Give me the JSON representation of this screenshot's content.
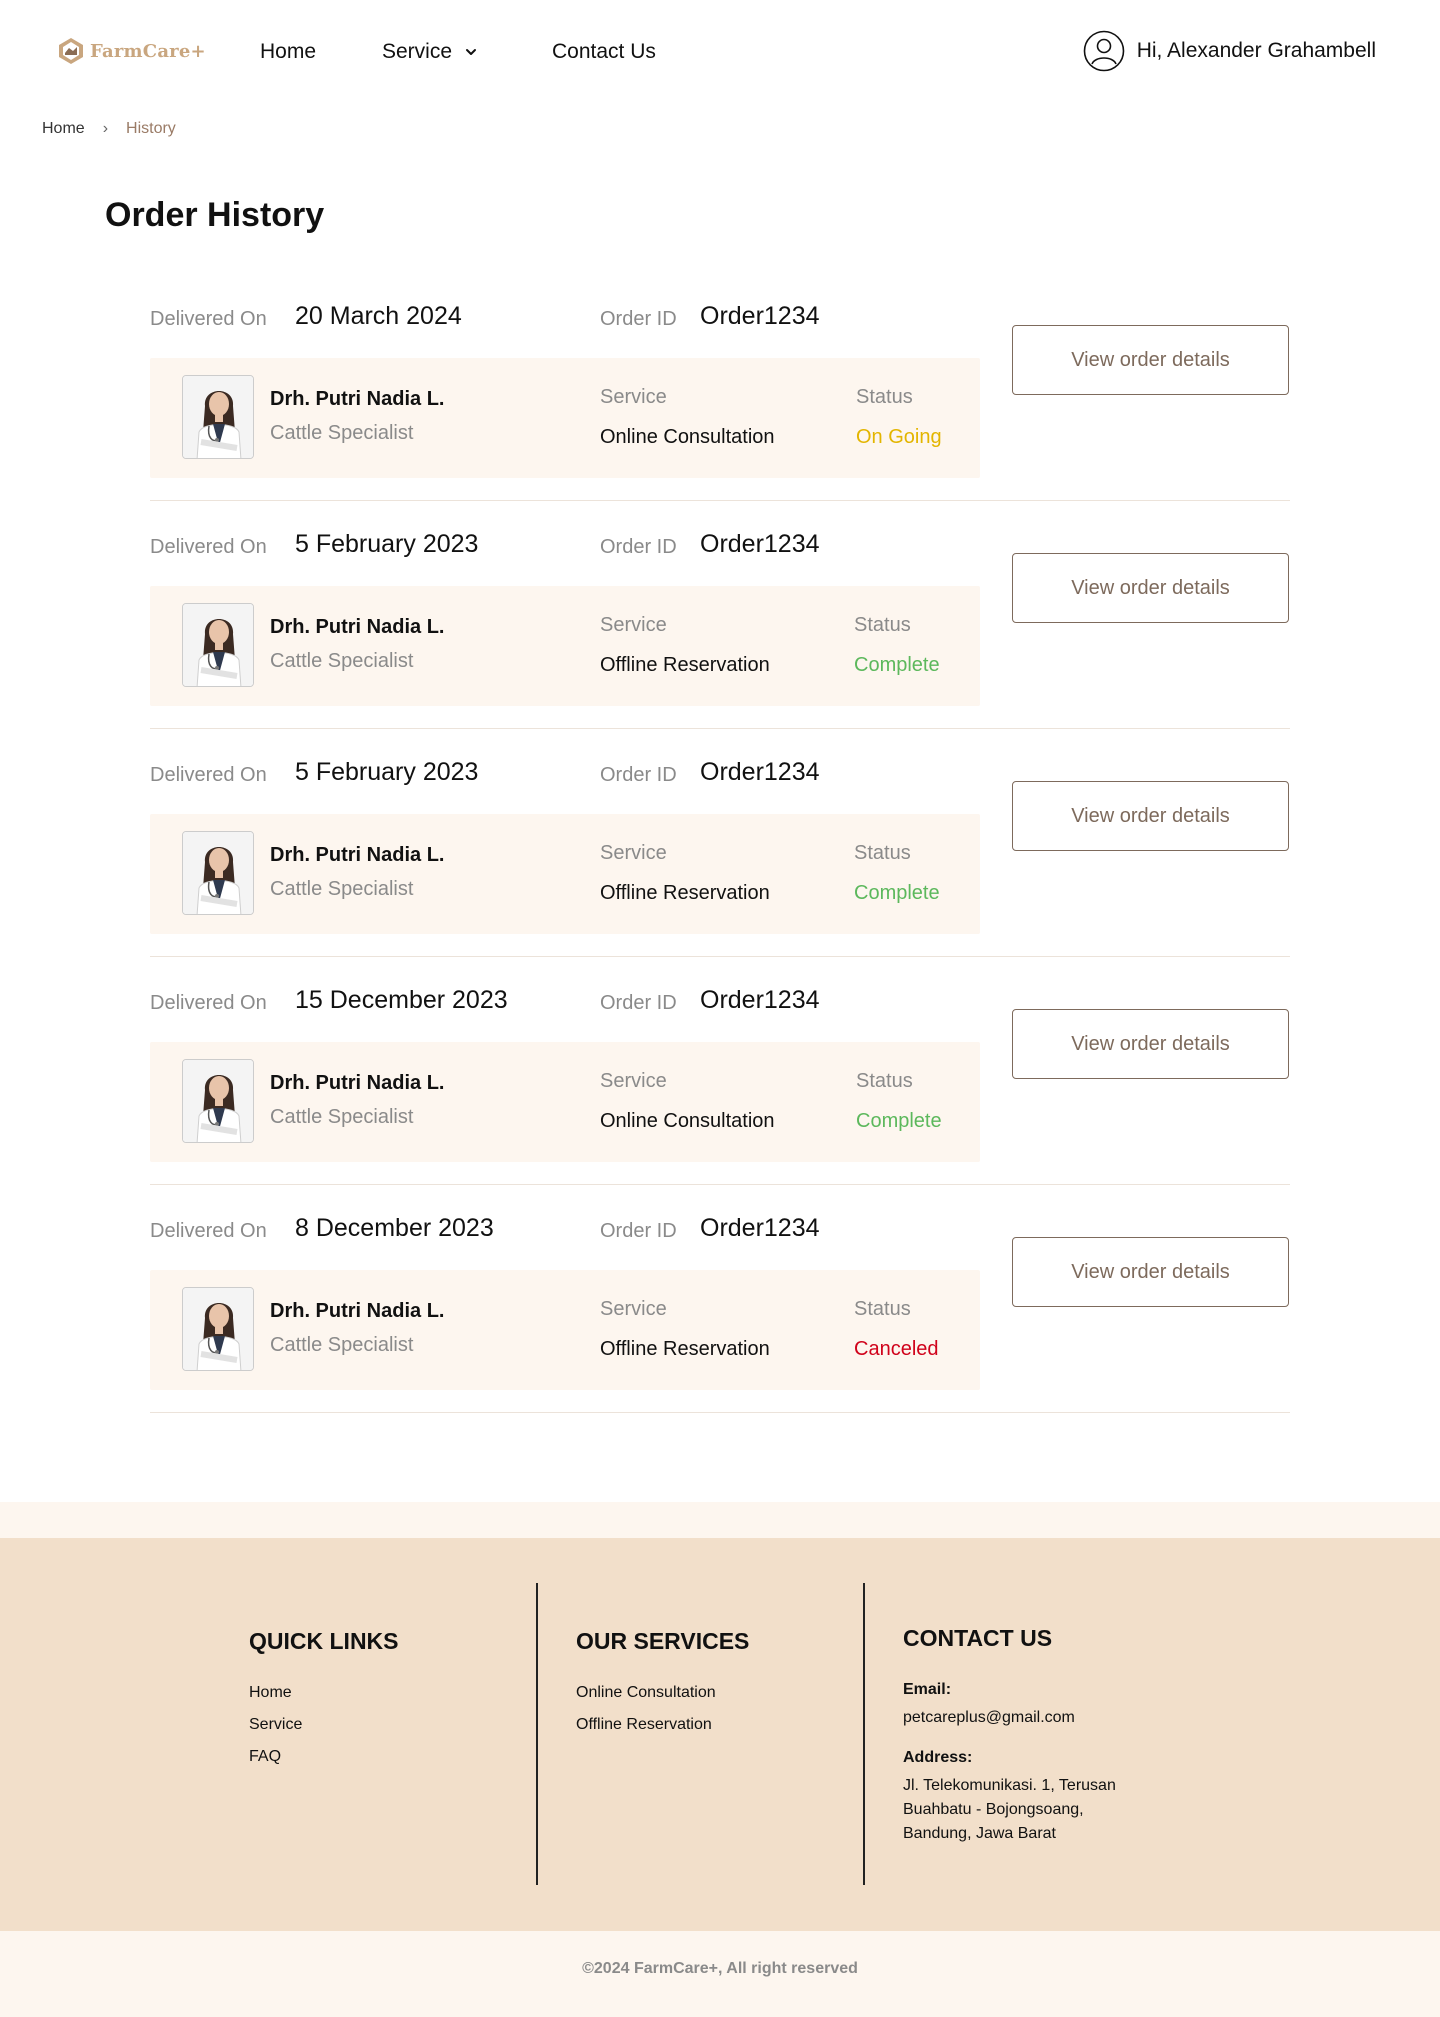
{
  "header": {
    "logo_text": "FarmCare+",
    "nav": {
      "home": "Home",
      "service": "Service",
      "contact": "Contact Us"
    },
    "user_greeting": "Hi, Alexander Grahambell"
  },
  "breadcrumb": {
    "home": "Home",
    "separator": "›",
    "current": "History"
  },
  "page_title": "Order History",
  "labels": {
    "delivered_on": "Delivered On",
    "order_id": "Order ID",
    "service": "Service",
    "status": "Status",
    "view_button": "View order details"
  },
  "orders": [
    {
      "date": "20 March 2024",
      "order_id": "Order1234",
      "doctor": "Drh. Putri Nadia L.",
      "role": "Cattle Specialist",
      "service": "Online Consultation",
      "status": "On Going",
      "status_color": "#e3b500"
    },
    {
      "date": "5 February 2023",
      "order_id": "Order1234",
      "doctor": "Drh. Putri Nadia L.",
      "role": "Cattle Specialist",
      "service": "Offline Reservation",
      "status": "Complete",
      "status_color": "#5cb85c"
    },
    {
      "date": "5 February 2023",
      "order_id": "Order1234",
      "doctor": "Drh. Putri Nadia L.",
      "role": "Cattle Specialist",
      "service": "Offline Reservation",
      "status": "Complete",
      "status_color": "#5cb85c"
    },
    {
      "date": "15 December 2023",
      "order_id": "Order1234",
      "doctor": "Drh. Putri Nadia L.",
      "role": "Cattle Specialist",
      "service": "Online Consultation",
      "status": "Complete",
      "status_color": "#5cb85c"
    },
    {
      "date": "8 December 2023",
      "order_id": "Order1234",
      "doctor": "Drh. Putri Nadia L.",
      "role": "Cattle Specialist",
      "service": "Offline Reservation",
      "status": "Canceled",
      "status_color": "#d0021b"
    }
  ],
  "footer": {
    "quick_links": {
      "title": "QUICK LINKS",
      "items": [
        "Home",
        "Service",
        "FAQ"
      ]
    },
    "our_services": {
      "title": "OUR SERVICES",
      "items": [
        "Online Consultation",
        "Offline Reservation"
      ]
    },
    "contact": {
      "title": "CONTACT US",
      "email_label": "Email:",
      "email": "petcareplus@gmail.com",
      "address_label": "Address:",
      "address_lines": [
        "Jl. Telekomunikasi. 1, Terusan",
        "Buahbatu - Bojongsoang,",
        "Bandung, Jawa Barat"
      ]
    },
    "copyright": "©2024 FarmCare+, All right reserved"
  },
  "colors": {
    "accent": "#7d6a5c",
    "logo": "#c9a67f",
    "card_bg": "#fdf6ef",
    "footer_bg": "#f2dfca"
  }
}
